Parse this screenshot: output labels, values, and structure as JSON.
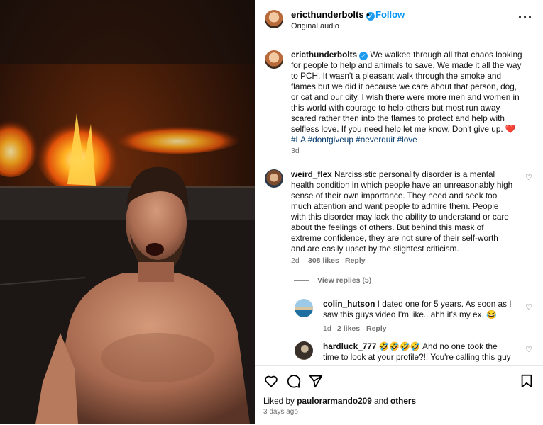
{
  "post": {
    "username": "ericthunderbolts",
    "follow_label": "Follow",
    "dot": "•",
    "audio": "Original audio",
    "more_icon": "···"
  },
  "caption": {
    "username": "ericthunderbolts",
    "lines": [
      " We walked through all that chaos looking",
      "for people to help and animals to save. We made it all the way",
      "to PCH. It wasn't a pleasant walk through the smoke and",
      "flames but we did it because we care about that person, dog,",
      "or cat and our city. I wish there were more men and women in",
      "this world with courage to help others but most run away",
      "scared rather then into the flames to protect and help with",
      "selfless love. If you need help let me know. Don't give up. ❤️"
    ],
    "hashtags": "#LA #dontgiveup #neverquit #love",
    "time": "3d"
  },
  "comments": [
    {
      "username": "weird_flex",
      "lines": [
        " Narcissistic personality disorder is a mental",
        "health condition in which people have an unreasonably high",
        "sense of their own importance. They need and seek too",
        "much attention and want people to admire them. People",
        "with this disorder may lack the ability to understand or care",
        "about the feelings of others. But behind this mask of",
        "extreme confidence, they are not sure of their self-worth",
        "and are easily upset by the slightest criticism."
      ],
      "time": "2d",
      "likes": "308 likes",
      "reply": "Reply"
    }
  ],
  "view_replies": "View replies (5)",
  "replies": [
    {
      "username": "colin_hutson",
      "lines": [
        " I dated one for 5 years. As soon as I",
        "saw this guys video I'm like.. ahh it's my ex. 😂"
      ],
      "time": "1d",
      "likes": "2 likes",
      "reply": "Reply"
    },
    {
      "username": "hardluck_777",
      "lines": [
        " 🤣🤣🤣🤣 And no one took the",
        "time to look at your profile?!! You're calling this guy"
      ]
    }
  ],
  "actions": {
    "liked_prefix": "Liked by ",
    "liked_user": "paulorarmando209",
    "liked_and": " and ",
    "liked_others": "others",
    "ago": "3 days ago"
  },
  "colors": {
    "link": "#0095f6",
    "verified": "#1d9bf0",
    "hashtag": "#00376b",
    "muted": "#737373"
  }
}
